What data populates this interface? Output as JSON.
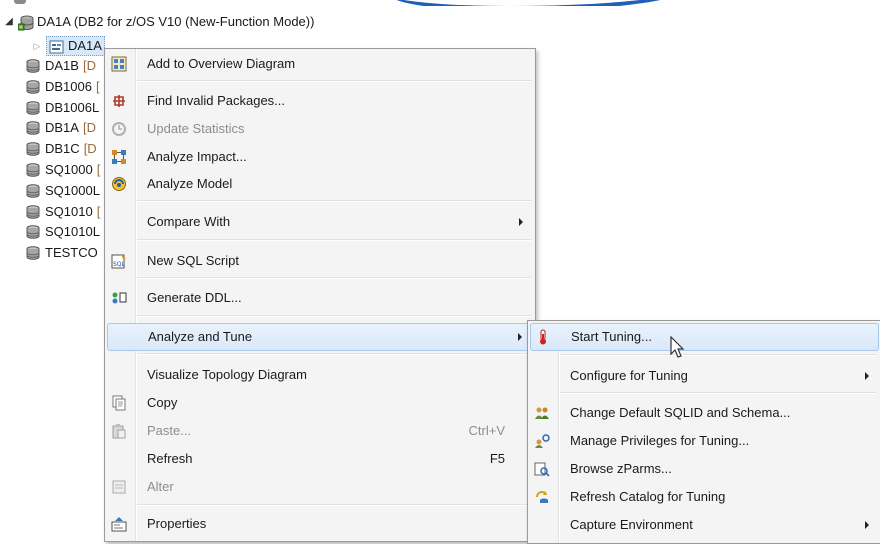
{
  "tree": {
    "root": {
      "label": "DA1A (DB2 for z/OS V10 (New-Function Mode))"
    },
    "child": {
      "label": "DA1A"
    },
    "siblings": [
      {
        "label": "DA1B",
        "suffix": "[D"
      },
      {
        "label": "DB1006",
        "suffix": "["
      },
      {
        "label": "DB1006L",
        "suffix": ""
      },
      {
        "label": "DB1A",
        "suffix": "[D"
      },
      {
        "label": "DB1C",
        "suffix": "[D"
      },
      {
        "label": "SQ1000",
        "suffix": "["
      },
      {
        "label": "SQ1000L",
        "suffix": ""
      },
      {
        "label": "SQ1010",
        "suffix": "["
      },
      {
        "label": "SQ1010L",
        "suffix": ""
      },
      {
        "label": "TESTCO",
        "suffix": ""
      }
    ]
  },
  "context_menu": {
    "items": [
      {
        "label": "Add to Overview Diagram",
        "icon": "overview-diagram-icon"
      },
      {
        "label": "Find Invalid Packages...",
        "icon": "find-packages-icon"
      },
      {
        "label": "Update Statistics",
        "icon": "update-statistics-icon",
        "disabled": true
      },
      {
        "label": "Analyze Impact...",
        "icon": "analyze-impact-icon"
      },
      {
        "label": "Analyze Model",
        "icon": "analyze-model-icon"
      },
      {
        "label": "Compare With",
        "submenu": true
      },
      {
        "label": "New SQL Script",
        "icon": "sql-script-icon"
      },
      {
        "label": "Generate DDL...",
        "icon": "generate-ddl-icon"
      },
      {
        "label": "Analyze and Tune",
        "submenu": true,
        "highlighted": true
      },
      {
        "label": "Visualize Topology Diagram"
      },
      {
        "label": "Copy",
        "icon": "copy-icon"
      },
      {
        "label": "Paste...",
        "icon": "paste-icon",
        "shortcut": "Ctrl+V",
        "disabled": true
      },
      {
        "label": "Refresh",
        "shortcut": "F5"
      },
      {
        "label": "Alter",
        "icon": "alter-icon",
        "disabled": true
      },
      {
        "label": "Properties",
        "icon": "properties-icon"
      }
    ]
  },
  "submenu": {
    "items": [
      {
        "label": "Start Tuning...",
        "icon": "thermometer-icon",
        "highlighted": true
      },
      {
        "label": "Configure for Tuning",
        "submenu": true
      },
      {
        "label": "Change Default SQLID and Schema...",
        "icon": "users-icon"
      },
      {
        "label": "Manage Privileges for Tuning...",
        "icon": "privileges-icon"
      },
      {
        "label": "Browse zParms...",
        "icon": "browse-icon"
      },
      {
        "label": "Refresh Catalog for Tuning",
        "icon": "refresh-catalog-icon"
      },
      {
        "label": "Capture Environment",
        "submenu": true
      }
    ]
  },
  "colors": {
    "highlight": "#d9e8f9",
    "highlight_border": "#a8c8ec",
    "disabled_text": "#8d8d8d",
    "menu_bg": "#f4f4f4"
  }
}
